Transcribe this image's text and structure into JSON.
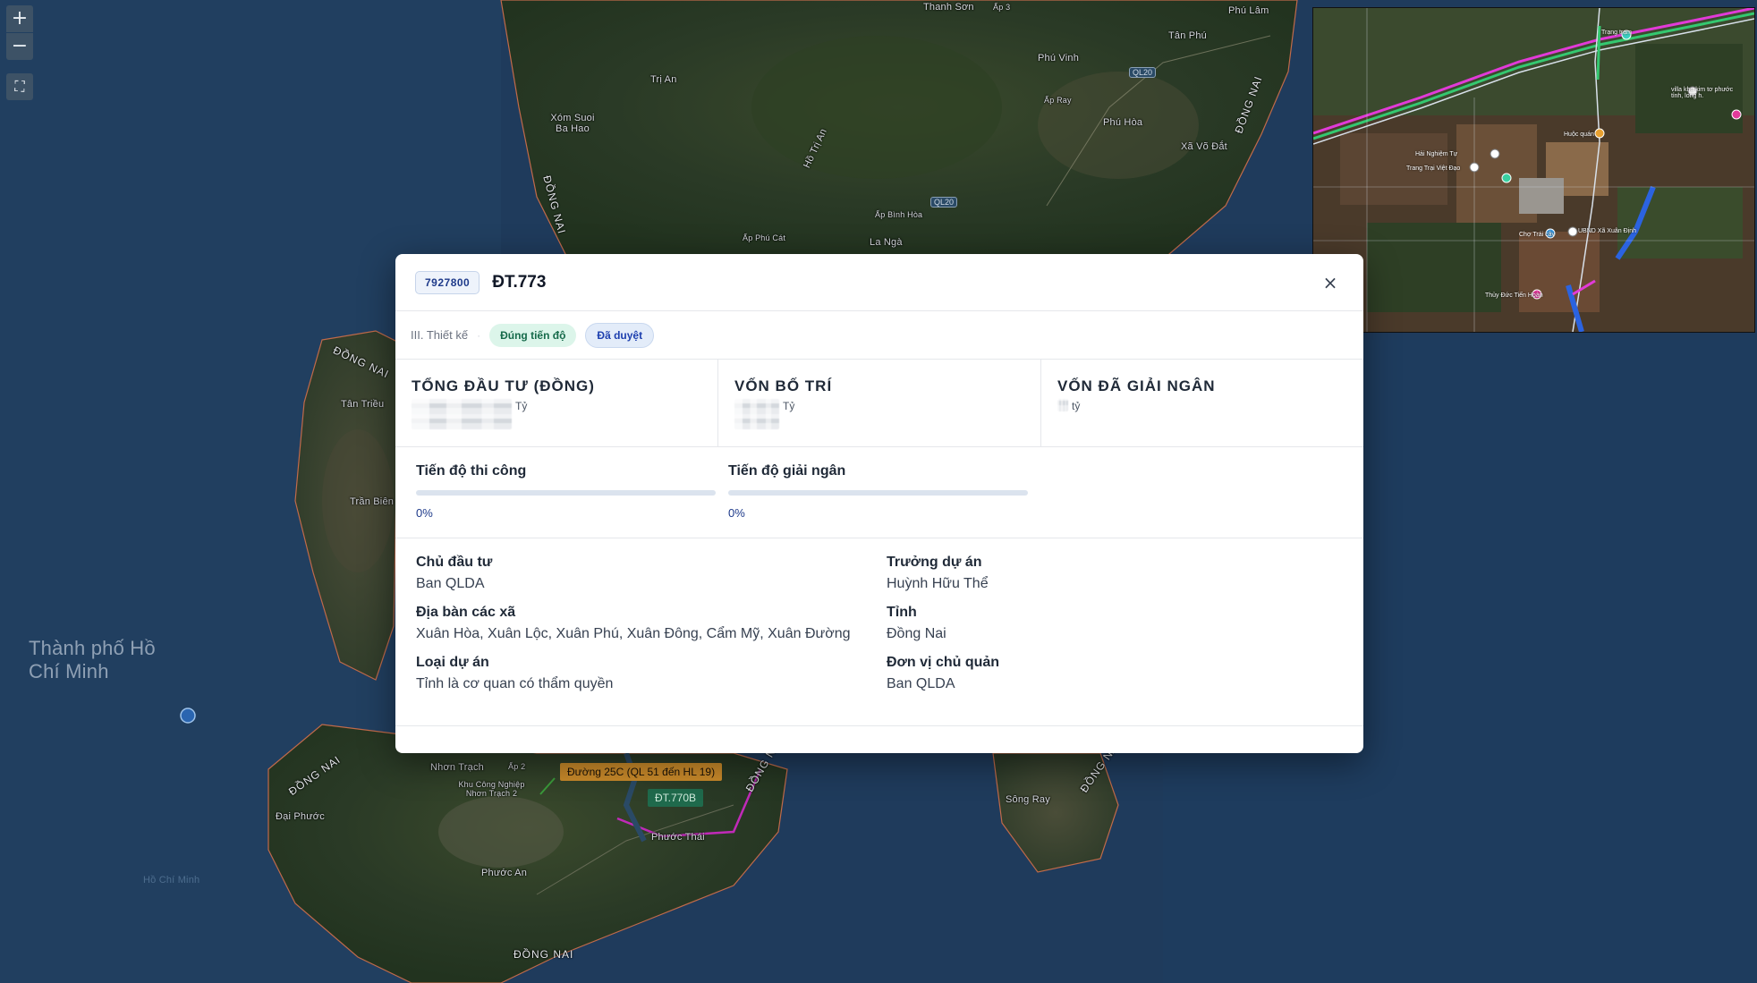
{
  "map": {
    "labels": [
      "Thanh Sơn",
      "Ấp 3",
      "Phú Lâm",
      "Tân Phú",
      "Phú Vinh",
      "Trị An",
      "Xóm Suoi Ba Hao",
      "Ấp Ray",
      "Phú Hòa",
      "Xã Võ Đắt",
      "Hồ Trị An",
      "Ấp Bình Hòa",
      "Ấp Phú Cát",
      "La Ngà",
      "Tân Triều",
      "Trần Biên",
      "Nhơn Trạch",
      "Ấp 2",
      "Khu Công Nghiệp Nhơn Trạch 2",
      "Phước Thái",
      "Phước An",
      "Đại Phước",
      "Sông Ray",
      "Hồ Chí Minh"
    ],
    "province_labels": [
      "ĐỒNG NAI",
      "ĐỒNG NAI",
      "ĐỒNG NAI",
      "ĐỒNG NAI",
      "ĐỒNG NAI",
      "ĐỒNG NAI",
      "ĐỒNG NAI"
    ],
    "city_label": "Thành phố Hồ Chí Minh",
    "shields": [
      "QL20",
      "QL20"
    ],
    "road_tags": [
      "Đường 25C (QL 51 đến HL 19)",
      "ĐT.770B"
    ]
  },
  "controls": {
    "zoom_in": "+",
    "zoom_out": "−",
    "fit": "⛶"
  },
  "minimap": {
    "labels": [
      "Trạng trạm",
      "villa khu kim tơ phước tỉnh, long h.",
      "Hải Nghiệm Tự",
      "Trang Trại Việt Đạo",
      "Huộc quán",
      "Chợ Trái cây",
      "UBND Xã Xuân Định",
      "Thủy Đức Tiến Hoàn"
    ]
  },
  "modal": {
    "code": "7927800",
    "title": "ĐT.773",
    "close": "×",
    "phase": "III. Thiết kế",
    "separator": "·",
    "tags": [
      "Đúng tiến độ",
      "Đã duyệt"
    ],
    "stats": [
      {
        "label": "TỔNG ĐẦU TƯ (ĐỒNG)",
        "unit": "Tỷ"
      },
      {
        "label": "VỐN BỐ TRÍ",
        "unit": "Tỷ"
      },
      {
        "label": "VỐN ĐÃ GIẢI NGÂN",
        "unit": "tỷ"
      }
    ],
    "progress": [
      {
        "label": "Tiến độ thi công",
        "value": "0%",
        "fraction": 0
      },
      {
        "label": "Tiến độ giải ngân",
        "value": "0%",
        "fraction": 0
      }
    ],
    "info": {
      "chu_dau_tu": {
        "label": "Chủ đầu tư",
        "value": "Ban QLDA"
      },
      "truong_du_an": {
        "label": "Trưởng dự án",
        "value": "Huỳnh Hữu Thể"
      },
      "dia_ban": {
        "label": "Địa bàn các xã",
        "value": "Xuân Hòa, Xuân Lộc, Xuân Phú, Xuân Đông, Cẩm Mỹ, Xuân Đường"
      },
      "tinh": {
        "label": "Tỉnh",
        "value": "Đồng Nai"
      },
      "loai_du_an": {
        "label": "Loại dự án",
        "value": "Tỉnh là cơ quan có thẩm quyền"
      },
      "don_vi": {
        "label": "Đơn vị chủ quản",
        "value": "Ban QLDA"
      }
    }
  }
}
